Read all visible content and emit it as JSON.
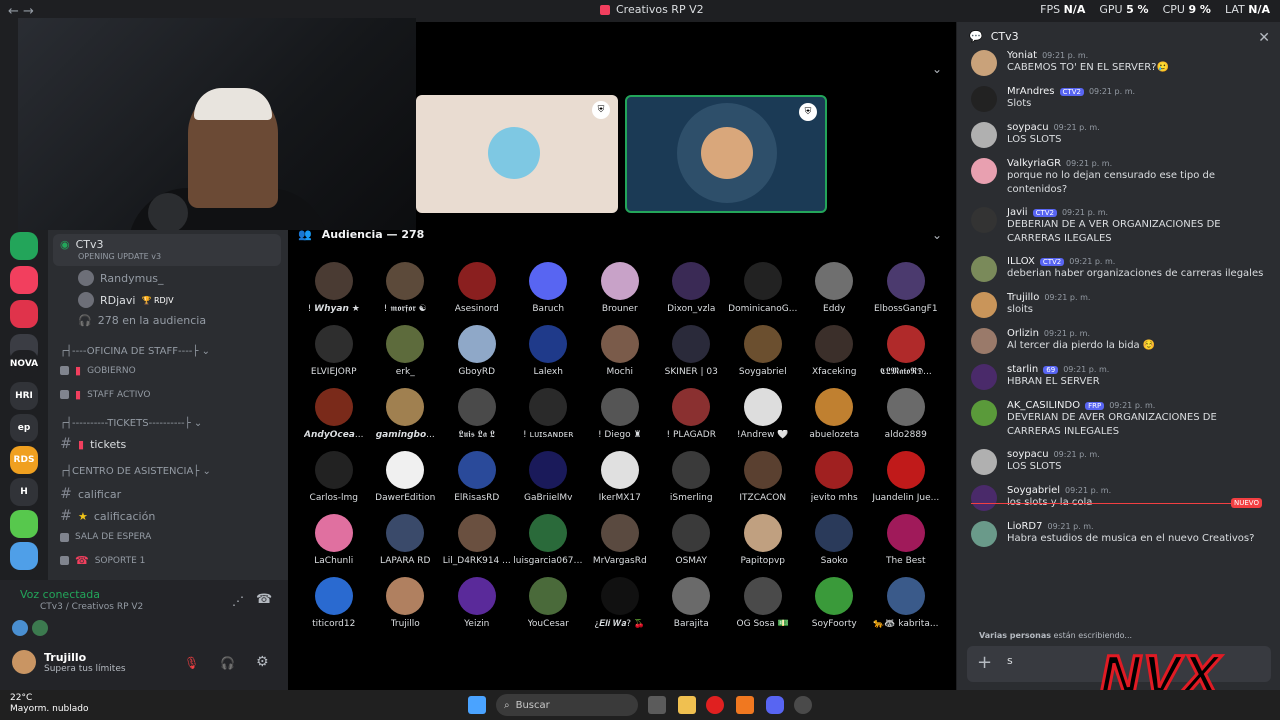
{
  "window": {
    "title": "Creativos RP V2",
    "nav": "← →"
  },
  "stats": {
    "fps_label": "FPS",
    "fps_value": "N/A",
    "gpu_label": "GPU",
    "gpu_value": "5 %",
    "cpu_label": "CPU",
    "cpu_value": "9 %",
    "lat_label": "LAT",
    "lat_value": "N/A"
  },
  "servers": [
    "NOVA",
    "HRI",
    "ep",
    "RDS",
    "H"
  ],
  "voice_channel": {
    "name": "CTv3",
    "subtitle": "OPENING UPDATE v3",
    "members": [
      "Randymus_",
      "RDjavi",
      "RDJV"
    ],
    "audience_text": "278 en la audiencia"
  },
  "categories": [
    {
      "name": "----OFICINA DE STAFF----",
      "channels": [
        "GOBIERNO",
        "STAFF ACTIVO"
      ]
    },
    {
      "name": "----------TICKETS----------",
      "channels": [
        "tickets"
      ]
    },
    {
      "name": "CENTRO DE ASISTENCIA",
      "channels": [
        "calificar",
        "calificación",
        "SALA DE ESPERA",
        "SOPORTE 1"
      ]
    }
  ],
  "voice_status": {
    "connected": "Voz conectada",
    "location": "CTv3 / Creativos RP V2"
  },
  "user": {
    "name": "Trujillo",
    "status": "Supera tus límites"
  },
  "stage": {
    "audience_title": "Audiencia — 278"
  },
  "audience": [
    "! 𝙒𝙝𝙮𝙖𝙣 ★",
    "! 𝖒𝖔𝖗𝖋𝖔𝖗 ☯",
    "Asesinord",
    "Baruch",
    "Brouner",
    "Dixon_vzla",
    "DominicanoG...",
    "Eddy",
    "ElbossGangF1",
    "ELVIEJORP",
    "erk_",
    "GboyRD",
    "Lalexh",
    "Mochi",
    "SKINER | 03",
    "Soygabriel",
    "Xfaceking",
    "𝕮𝕷𝕸𝖆𝖙𝖔𝕽𝕯...",
    "𝘼𝙣𝙙𝙮𝙊𝙘𝙚𝙖...",
    "𝙜𝙖𝙢𝙞𝙣𝙜𝙗𝙤...",
    "𝕷𝖚𝖎𝖘 𝕷𝖆 𝕷",
    "! ʟᴜɪꜱᴀɴᴅᴇʀ",
    "! Diego ♜",
    "! PLAGADR",
    "!Andrew 🤍",
    "abuelozeta",
    "aldo2889",
    "Carlos-lmg",
    "DawerEdition",
    "ElRisasRD",
    "GaBriielMv",
    "IkerMX17",
    "iSmerling",
    "ITZCACON",
    "jevito mhs",
    "Juandelin Jue...",
    "LaChunli",
    "LAPARA RD",
    "Lil_D4RK914 ...",
    "luisgarcia06761",
    "MrVargasRd",
    "OSMAY",
    "Papitopvp",
    "Saoko",
    "The Best",
    "titicord12",
    "Trujillo",
    "Yeizin",
    "YouCesar",
    "¿𝑬𝒍𝒊 𝑾𝒂? 🍒",
    "Barajita",
    "OG Sosa 💵",
    "SoyFoorty",
    "🐆🦝 kabrita..."
  ],
  "chat": {
    "channel": "CTv3",
    "messages": [
      {
        "author": "Yoniat",
        "time": "09:21 p. m.",
        "text": "CABEMOS TO' EN EL SERVER?🥲"
      },
      {
        "author": "MrAndres",
        "tag": "CTV2",
        "time": "09:21 p. m.",
        "text": "Slots"
      },
      {
        "author": "soypacu",
        "time": "09:21 p. m.",
        "text": "LOS SLOTS"
      },
      {
        "author": "ValkyriaGR",
        "time": "09:21 p. m.",
        "text": "porque no lo dejan censurado ese tipo de contenidos?"
      },
      {
        "author": "Javii",
        "tag": "CTV2",
        "time": "09:21 p. m.",
        "text": "DEBERIAN DE A VER ORGANIZACIONES  DE CARRERAS ILEGALES"
      },
      {
        "author": "ILLOX",
        "tag": "CTV2",
        "time": "09:21 p. m.",
        "text": "deberian haber organizaciones de carreras ilegales"
      },
      {
        "author": "Trujillo",
        "time": "09:21 p. m.",
        "text": "sloits"
      },
      {
        "author": "Orlizin",
        "time": "09:21 p. m.",
        "text": "Al tercer dia pierdo la bida ☺️"
      },
      {
        "author": "starlin",
        "tag": "69",
        "time": "09:21 p. m.",
        "text": "HBRAN EL SERVER"
      },
      {
        "author": "AK_CASILINDO",
        "tag": "FRP",
        "time": "09:21 p. m.",
        "text": "DEVERIAN DE AVER  ORGANIZACIONES  DE CARRERAS INLEGALES"
      },
      {
        "author": "soypacu",
        "time": "09:21 p. m.",
        "text": "LOS SLOTS"
      },
      {
        "author": "Soygabriel",
        "time": "09:21 p. m.",
        "text": "los slots y la cola"
      },
      {
        "author": "LioRD7",
        "time": "09:21 p. m.",
        "text": "Habra estudios de musica en el nuevo Creativos?"
      }
    ],
    "new_badge": "NUEVO",
    "typing_who": "Varias personas",
    "typing_rest": "están escribiendo...",
    "draft": "s"
  },
  "overlay": {
    "logo": "NVX"
  },
  "taskbar": {
    "temp": "22°C",
    "weather": "Mayorm. nublado",
    "search": "Buscar"
  },
  "colors": {
    "online": "#23a55a",
    "accent": "#5865f2",
    "new": "#f23f42"
  }
}
